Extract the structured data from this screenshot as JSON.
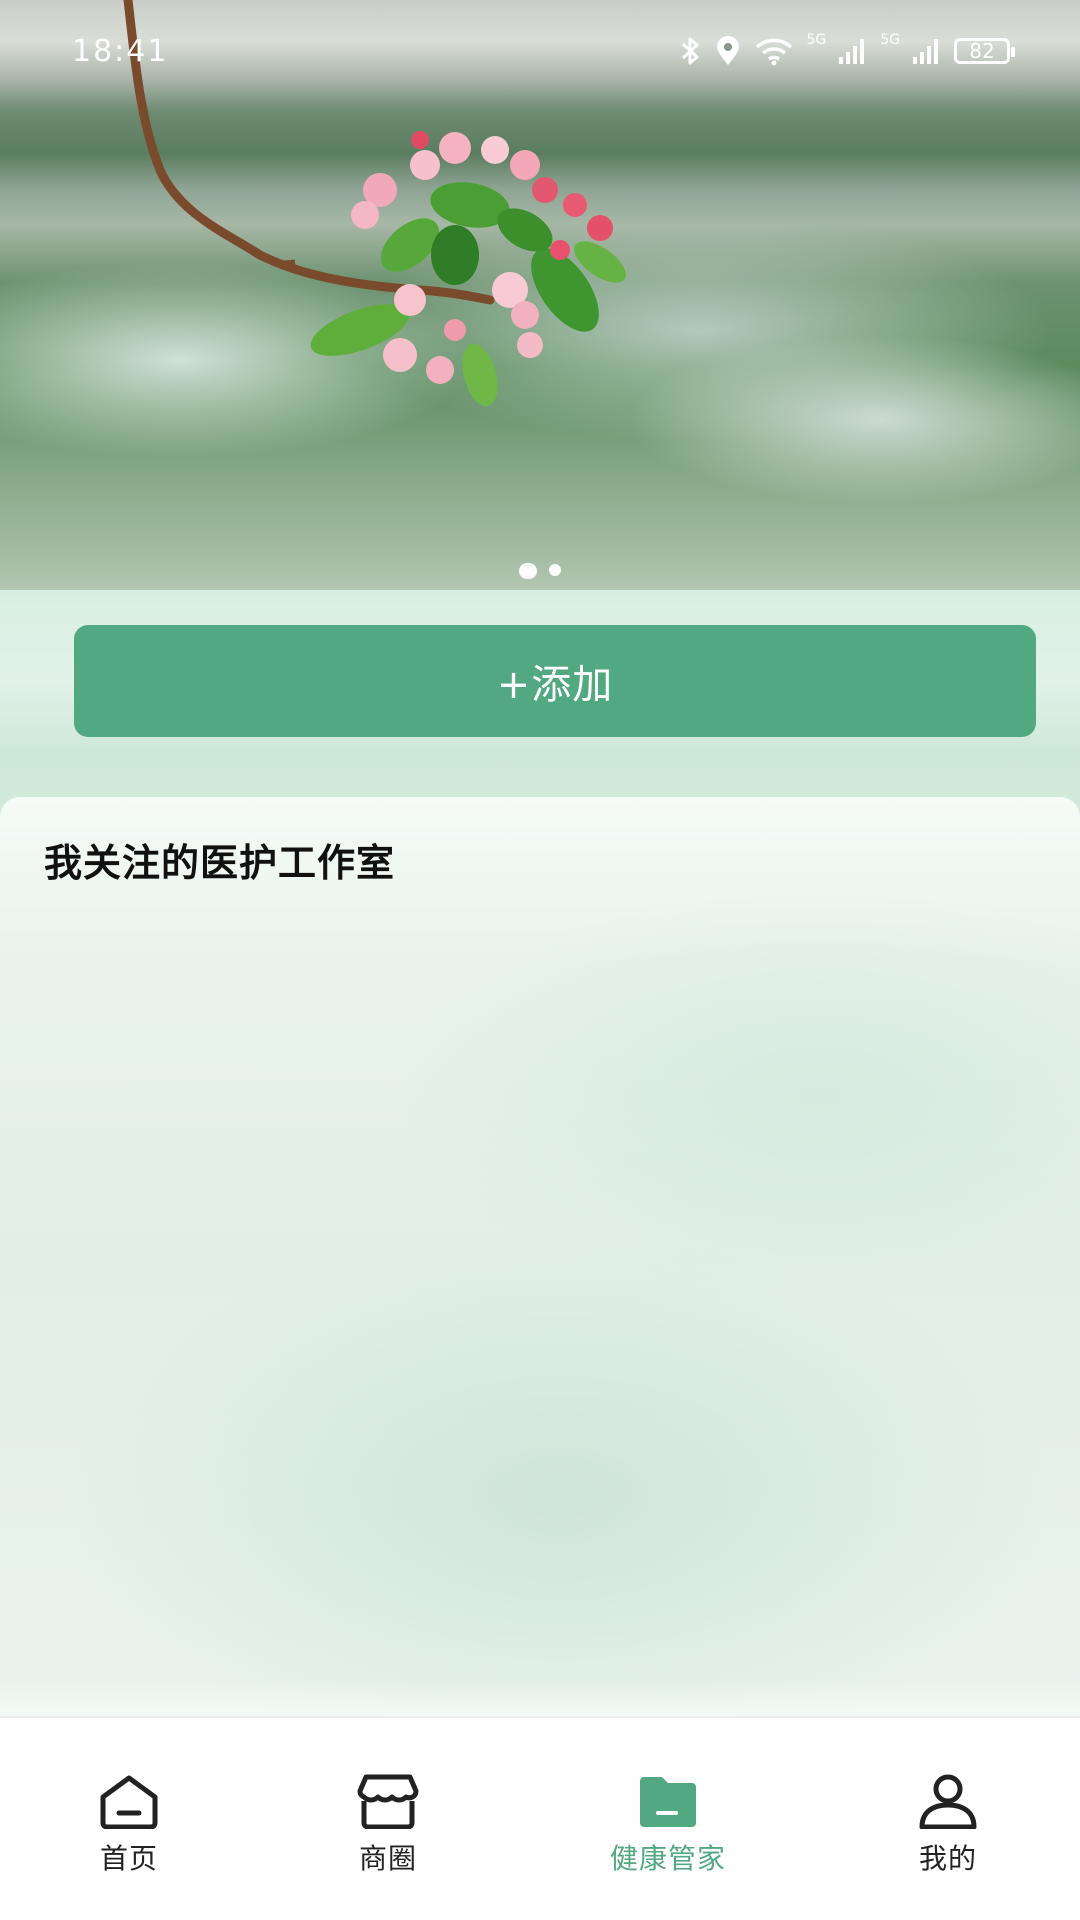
{
  "status_bar": {
    "time": "18:41",
    "network_labels": [
      "5G",
      "5G"
    ],
    "battery": "82",
    "icons": [
      "bluetooth-icon",
      "location-icon",
      "wifi-icon",
      "signal-icon",
      "signal-icon",
      "battery-icon"
    ]
  },
  "banner": {
    "image": "flower-branch-photo",
    "slide_count": 2,
    "active_slide": 1
  },
  "actions": {
    "add_label": "+添加"
  },
  "followed_section": {
    "title": "我关注的医护工作室",
    "items": []
  },
  "bottom_nav": {
    "items": [
      {
        "label": "首页",
        "icon": "home-icon",
        "active": false
      },
      {
        "label": "商圈",
        "icon": "store-icon",
        "active": false
      },
      {
        "label": "健康管家",
        "icon": "folder-icon",
        "active": true
      },
      {
        "label": "我的",
        "icon": "user-icon",
        "active": false
      }
    ]
  },
  "colors": {
    "accent": "#52a881",
    "nav_text": "#222222",
    "status_text": "#ffffff"
  }
}
